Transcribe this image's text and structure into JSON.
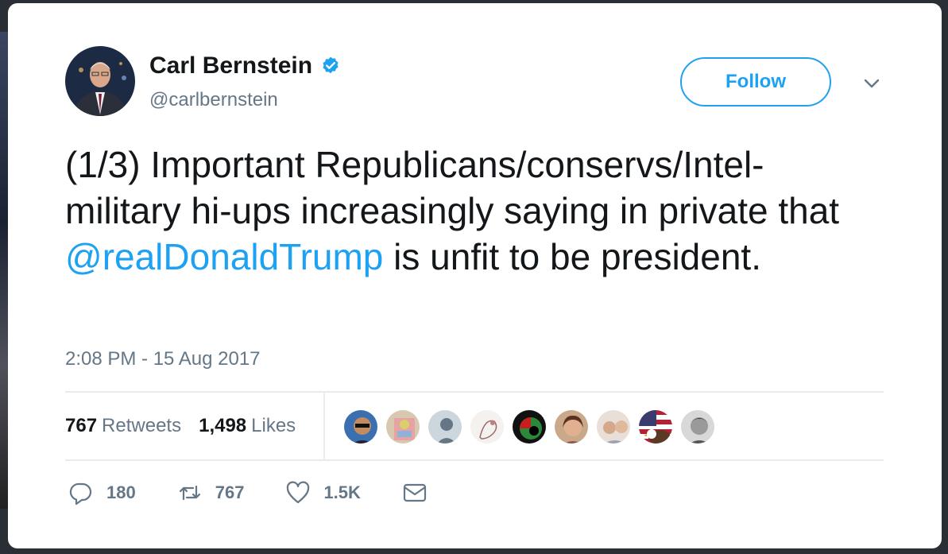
{
  "user": {
    "name": "Carl Bernstein",
    "handle": "@carlbernstein"
  },
  "follow_label": "Follow",
  "tweet": {
    "text_before": "(1/3) Important Republicans/conservs/Intel-military hi-ups increasingly saying in private that ",
    "mention": "@realDonaldTrump",
    "text_after": " is unfit to be president."
  },
  "timestamp": "2:08 PM - 15 Aug 2017",
  "stats": {
    "retweets_count": "767",
    "retweets_label": "Retweets",
    "likes_count": "1,498",
    "likes_label": "Likes"
  },
  "actions": {
    "reply_count": "180",
    "retweet_count": "767",
    "like_count": "1.5K"
  },
  "colors": {
    "accent": "#1da1f2",
    "text": "#14171a",
    "muted": "#657786"
  },
  "icons": [
    "verified-badge-icon",
    "chevron-down-icon",
    "reply-icon",
    "retweet-icon",
    "heart-icon",
    "direct-message-icon"
  ]
}
